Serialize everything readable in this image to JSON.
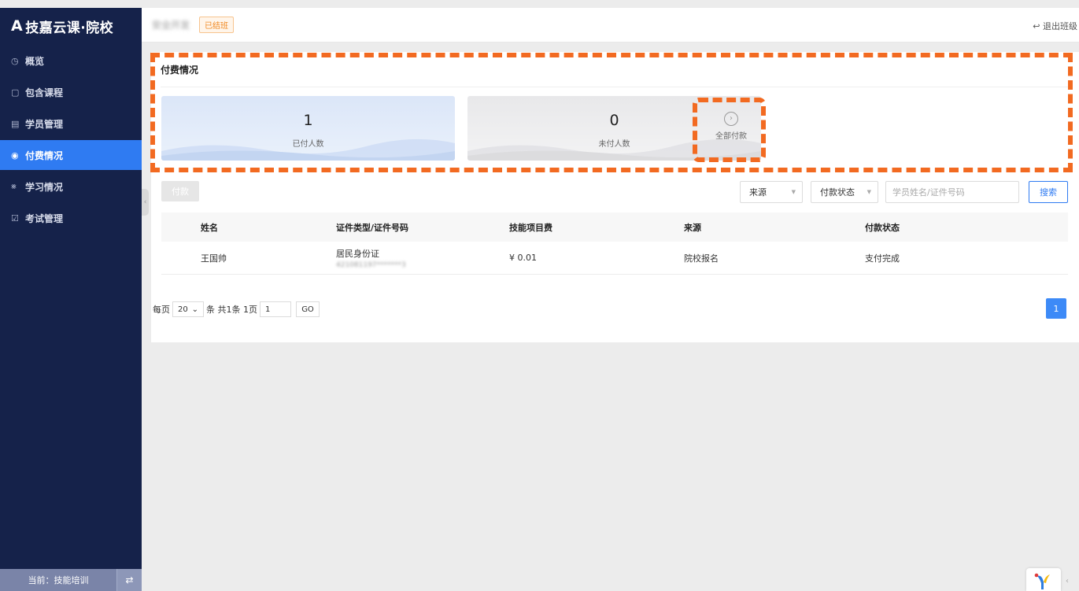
{
  "brand": {
    "logo_mark": "A",
    "name": "技嘉云课·院校"
  },
  "sidebar": {
    "items": [
      {
        "icon": "clock-icon",
        "glyph": "◷",
        "label": "概览",
        "active": false
      },
      {
        "icon": "book-icon",
        "glyph": "▢",
        "label": "包含课程",
        "active": false
      },
      {
        "icon": "list-icon",
        "glyph": "▤",
        "label": "学员管理",
        "active": false
      },
      {
        "icon": "payment-icon",
        "glyph": "◉",
        "label": "付费情况",
        "active": true
      },
      {
        "icon": "study-icon",
        "glyph": "⨳",
        "label": "学习情况",
        "active": false
      },
      {
        "icon": "exam-icon",
        "glyph": "☑",
        "label": "考试管理",
        "active": false
      }
    ],
    "footer": {
      "current": "当前：技能培训",
      "switch_glyph": "⇄"
    }
  },
  "header": {
    "class_name": "安全开发",
    "status": "已结班",
    "exit": "退出班级"
  },
  "panel": {
    "title": "付费情况",
    "stats": {
      "paid_count": "1",
      "paid_label": "已付人数",
      "unpaid_count": "0",
      "unpaid_label": "未付人数",
      "all_pay_label": "全部付款"
    },
    "toolbar": {
      "pay_button": "付款",
      "source_select": "来源",
      "status_select": "付款状态",
      "search_placeholder": "学员姓名/证件号码",
      "search_button": "搜索"
    },
    "table": {
      "headers": [
        "姓名",
        "证件类型/证件号码",
        "技能项目费",
        "来源",
        "付款状态"
      ],
      "rows": [
        {
          "name": "王国帅",
          "id_type": "居民身份证",
          "id_number": "421081197*******3",
          "fee": "¥ 0.01",
          "source": "院校报名",
          "status": "支付完成"
        }
      ]
    },
    "pagination": {
      "per_page_prefix": "每页",
      "per_page": "20",
      "summary": "条 共1条 1页",
      "page_input": "1",
      "go": "GO",
      "current_page": "1"
    }
  },
  "colors": {
    "sidebar_bg": "#15224a",
    "accent": "#2f7bf2",
    "highlight_dash": "#f26a21",
    "status_tag": "#f08a24"
  }
}
